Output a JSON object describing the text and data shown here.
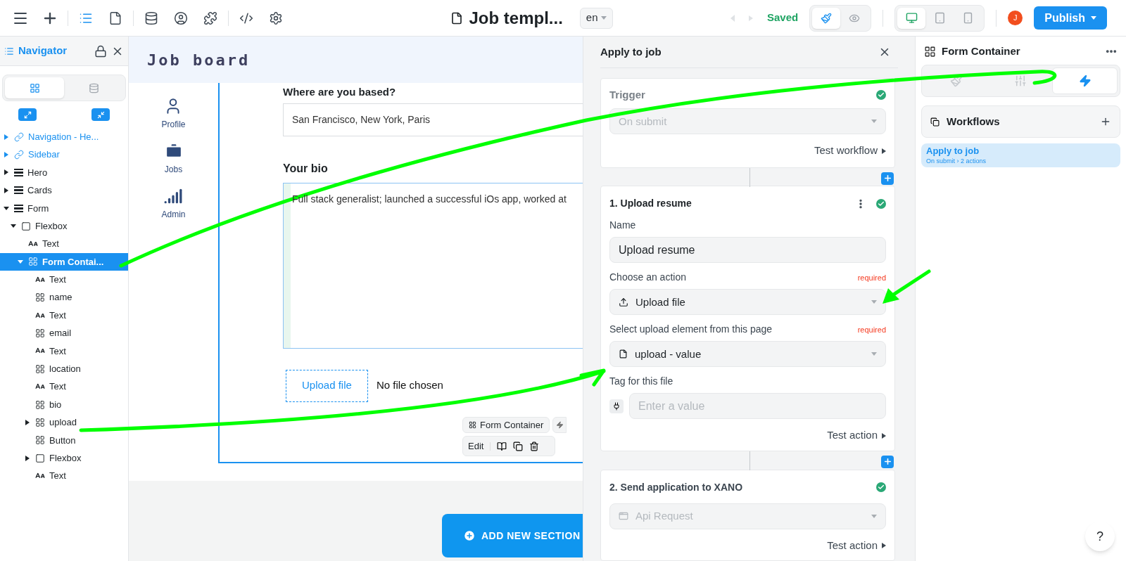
{
  "toolbar": {
    "tools": [
      {
        "selected": false
      },
      {
        "selected": false
      },
      {
        "selected": true
      },
      {
        "selected": false
      },
      {
        "selected": false
      },
      {
        "selected": false
      },
      {
        "selected": false
      },
      {
        "selected": false
      },
      {
        "selected": false
      }
    ],
    "page_title": "Job templ...",
    "language": "en",
    "save_status": "Saved",
    "modes": [
      {
        "selected": true
      },
      {
        "selected": false
      }
    ],
    "devices": [
      {
        "selected": true
      },
      {
        "selected": false
      },
      {
        "selected": false
      }
    ],
    "user_initial": "J",
    "publish": "Publish"
  },
  "navigator": {
    "title": "Navigator",
    "views": [
      {
        "selected": true
      },
      {
        "selected": false
      }
    ],
    "tree": [
      {
        "label": "Navigation - He...",
        "kind": "link",
        "expanded": false,
        "selected": false
      },
      {
        "label": "Sidebar",
        "kind": "link",
        "expanded": false,
        "selected": false
      },
      {
        "label": "Hero",
        "kind": "section",
        "expanded": false,
        "selected": false
      },
      {
        "label": "Cards",
        "kind": "section",
        "expanded": false,
        "selected": false
      },
      {
        "label": "Form",
        "kind": "section",
        "expanded": true,
        "selected": false,
        "children": [
          {
            "label": "Flexbox",
            "kind": "box",
            "expanded": true,
            "selected": false,
            "children": [
              {
                "label": "Text",
                "kind": "text",
                "selected": false
              },
              {
                "label": "Form Contai...",
                "kind": "grid",
                "expanded": true,
                "selected": true,
                "children": [
                  {
                    "label": "Text",
                    "kind": "text",
                    "selected": false
                  },
                  {
                    "label": "name",
                    "kind": "grid",
                    "selected": false
                  },
                  {
                    "label": "Text",
                    "kind": "text",
                    "selected": false
                  },
                  {
                    "label": "email",
                    "kind": "grid",
                    "selected": false
                  },
                  {
                    "label": "Text",
                    "kind": "text",
                    "selected": false
                  },
                  {
                    "label": "location",
                    "kind": "grid",
                    "selected": false
                  },
                  {
                    "label": "Text",
                    "kind": "text",
                    "selected": false
                  },
                  {
                    "label": "bio",
                    "kind": "grid",
                    "selected": false
                  },
                  {
                    "label": "upload",
                    "kind": "grid",
                    "expanded": false,
                    "selected": false
                  },
                  {
                    "label": "Button",
                    "kind": "grid",
                    "selected": false
                  },
                  {
                    "label": "Flexbox",
                    "kind": "box",
                    "expanded": false,
                    "selected": false
                  },
                  {
                    "label": "Text",
                    "kind": "text",
                    "selected": false
                  }
                ]
              }
            ]
          }
        ]
      }
    ]
  },
  "canvas": {
    "site_title": "Job board",
    "nav": [
      {
        "label": "Profile"
      },
      {
        "label": "Jobs"
      },
      {
        "label": "Admin"
      }
    ],
    "location_label": "Where are you based?",
    "location_value": "San Francisco, New York, Paris",
    "bio_label": "Your bio",
    "bio_value": "Full stack generalist; launched a successful iOs app, worked at",
    "upload_button": "Upload file",
    "upload_status": "No file chosen",
    "element_chip": "Form Container",
    "edit_label": "Edit",
    "add_section": "ADD NEW SECTION"
  },
  "workflow_panel": {
    "title": "Apply to job",
    "trigger": {
      "title": "Trigger",
      "done": true,
      "value": "On submit",
      "disabled": true,
      "test": "Test workflow"
    },
    "actions": [
      {
        "title": "1. Upload resume",
        "done": true,
        "kind": "form",
        "test": "Test action",
        "fields": [
          {
            "label": "Name",
            "kind": "text",
            "value": "Upload resume"
          },
          {
            "label": "Choose an action",
            "required": "required",
            "kind": "select",
            "value": "Upload file",
            "disabled": false
          },
          {
            "label": "Select upload element from this page",
            "required": "required",
            "kind": "select",
            "value": "upload - value",
            "disabled": false
          },
          {
            "label": "Tag for this file",
            "kind": "bound",
            "placeholder": "Enter a value"
          }
        ]
      },
      {
        "title": "2. Send application to XANO",
        "done": true,
        "kind": "select",
        "value": "Api Request",
        "disabled": true,
        "test": "Test action"
      }
    ]
  },
  "properties": {
    "title": "Form Container",
    "tabs": [
      {
        "selected": false
      },
      {
        "selected": false
      },
      {
        "selected": true
      }
    ],
    "section": "Workflows",
    "workflows": [
      {
        "name": "Apply to job",
        "summary": "On submit › 2 actions",
        "selected": true
      }
    ]
  },
  "help": "?"
}
